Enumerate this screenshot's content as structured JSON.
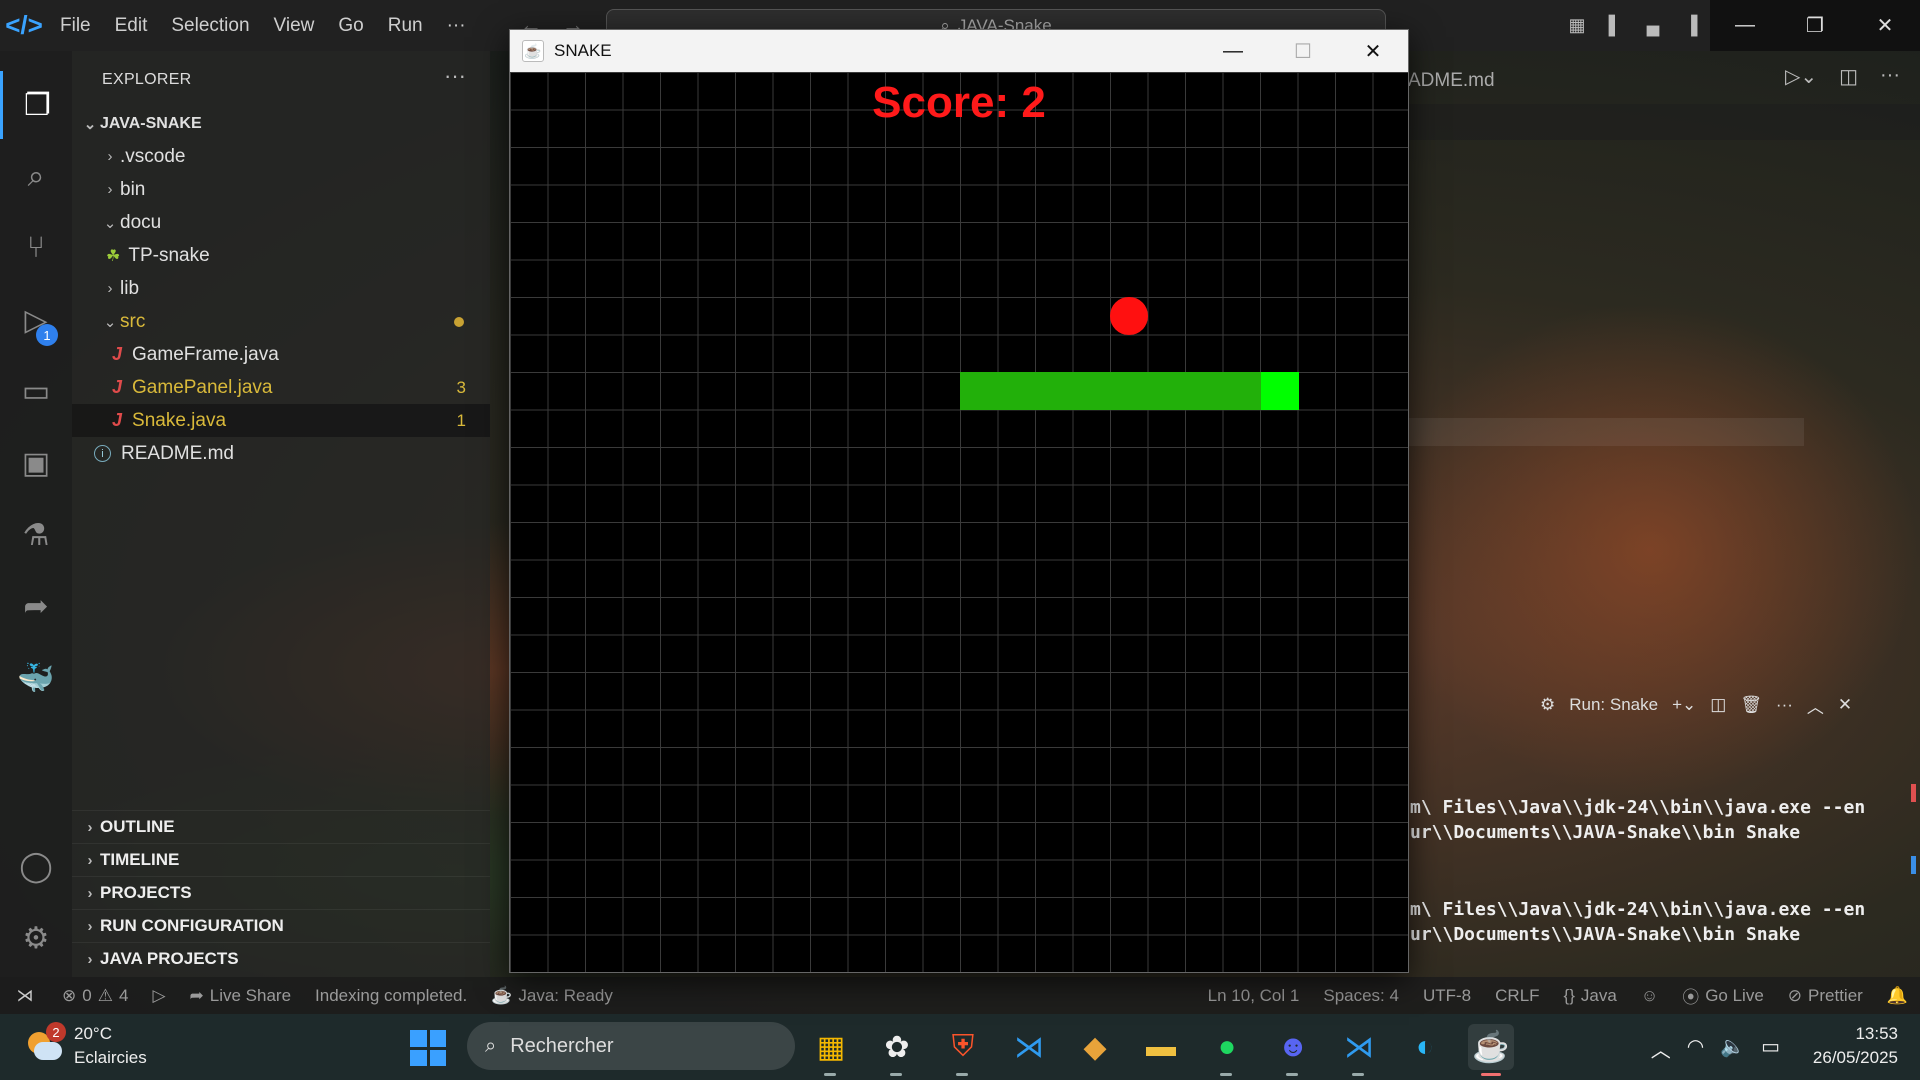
{
  "titlebar": {
    "menu": [
      "File",
      "Edit",
      "Selection",
      "View",
      "Go",
      "Run",
      "···"
    ],
    "command_center": "JAVA-Snake"
  },
  "activitybar": {
    "debug_badge": "1"
  },
  "explorer": {
    "title": "EXPLORER",
    "more": "···",
    "root": "JAVA-SNAKE",
    "items": [
      {
        "label": ".vscode",
        "kind": "folder-collapsed"
      },
      {
        "label": "bin",
        "kind": "folder-collapsed"
      },
      {
        "label": "docu",
        "kind": "folder-expanded"
      },
      {
        "label": "TP-snake",
        "kind": "file-snake"
      },
      {
        "label": "lib",
        "kind": "folder-collapsed"
      },
      {
        "label": "src",
        "kind": "folder-expanded",
        "modified": true
      },
      {
        "label": "GameFrame.java",
        "kind": "java"
      },
      {
        "label": "GamePanel.java",
        "kind": "java",
        "problems": "3"
      },
      {
        "label": "Snake.java",
        "kind": "java",
        "problems": "1",
        "selected": true
      },
      {
        "label": "README.md",
        "kind": "info"
      }
    ],
    "sections": [
      "OUTLINE",
      "TIMELINE",
      "PROJECTS",
      "RUN CONFIGURATION",
      "JAVA PROJECTS"
    ]
  },
  "editor": {
    "tab_fragment": "ADME.md"
  },
  "panel": {
    "terminal_name": "Run: Snake",
    "lines": [
      "m\\ Files\\\\Java\\\\jdk-24\\\\bin\\\\java.exe --en",
      "ur\\\\Documents\\\\JAVA-Snake\\\\bin Snake",
      "m\\ Files\\\\Java\\\\jdk-24\\\\bin\\\\java.exe --en",
      "ur\\\\Documents\\\\JAVA-Snake\\\\bin Snake"
    ]
  },
  "statusbar": {
    "errors": "0",
    "warnings": "4",
    "live_share": "Live Share",
    "indexing": "Indexing completed.",
    "java_status": "Java: Ready",
    "position": "Ln 10, Col 1",
    "spaces": "Spaces: 4",
    "encoding": "UTF-8",
    "eol": "CRLF",
    "language": "Java",
    "go_live": "Go Live",
    "prettier": "Prettier"
  },
  "snake_window": {
    "title": "SNAKE",
    "score_text": "Score: 2",
    "colors": {
      "apple": "#ff1010",
      "body": "#22b00a",
      "head": "#00ff00",
      "score": "#ff1a1a",
      "grid": "#3a3a3a"
    },
    "grid_cells": 24,
    "apple_cell": [
      16,
      6
    ],
    "snake_cells": [
      [
        20,
        8
      ],
      [
        19,
        8
      ],
      [
        18,
        8
      ],
      [
        17,
        8
      ],
      [
        16,
        8
      ],
      [
        15,
        8
      ],
      [
        14,
        8
      ],
      [
        13,
        8
      ],
      [
        12,
        8
      ]
    ]
  },
  "taskbar": {
    "weather_temp": "20°C",
    "weather_desc": "Eclaircies",
    "weather_badge": "2",
    "search_placeholder": "Rechercher",
    "time": "13:53",
    "date": "26/05/2025"
  }
}
